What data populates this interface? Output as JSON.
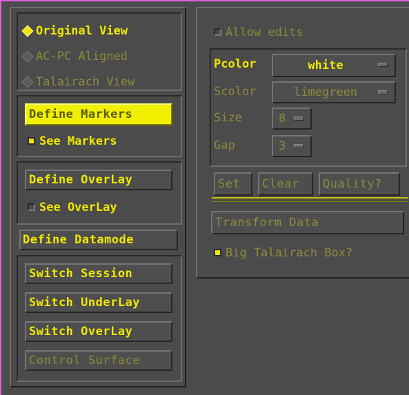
{
  "view_modes": [
    {
      "label": "Original View",
      "selected": true,
      "enabled": true
    },
    {
      "label": "AC-PC Aligned",
      "selected": false,
      "enabled": false
    },
    {
      "label": "Talairach View",
      "selected": false,
      "enabled": false
    }
  ],
  "markers": {
    "define_label": "Define Markers",
    "see_label": "See Markers",
    "see_checked": true
  },
  "overlay": {
    "define_label": "Define OverLay",
    "see_label": "See OverLay",
    "see_checked": false
  },
  "datamode": {
    "define_label": "Define Datamode"
  },
  "switches": {
    "session": "Switch Session",
    "underlay": "Switch UnderLay",
    "overlay": "Switch OverLay",
    "control_surface": "Control Surface"
  },
  "right_panel": {
    "allow_edits_label": "Allow edits",
    "allow_edits_checked": false,
    "pcolor_label": "Pcolor",
    "pcolor_value": "white",
    "scolor_label": "Scolor",
    "scolor_value": "limegreen",
    "size_label": "Size",
    "size_value": "8",
    "gap_label": "Gap",
    "gap_value": "3",
    "set_label": "Set",
    "clear_label": "Clear",
    "quality_label": "Quality?",
    "transform_label": "Transform Data",
    "big_box_label": "Big Talairach Box?",
    "big_box_checked": true
  },
  "colors": {
    "accent": "#f0e800",
    "disabled": "#8f8a3a",
    "background": "#4b4b4b",
    "frame": "#e060e0"
  }
}
